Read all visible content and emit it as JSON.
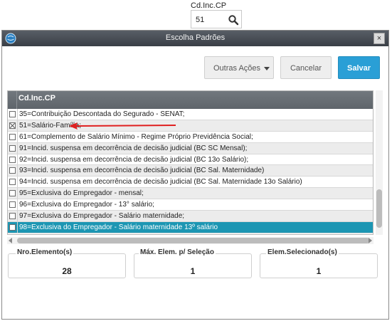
{
  "field": {
    "label": "Cd.Inc.CP",
    "value": "51",
    "icon": "search-icon"
  },
  "dialog": {
    "title": "Escolha Padrões",
    "close_label": "×",
    "app_icon": "app-globe-icon"
  },
  "toolbar": {
    "actions_label": "Outras Ações",
    "cancel_label": "Cancelar",
    "save_label": "Salvar"
  },
  "grid": {
    "column_header": "Cd.Inc.CP",
    "rows": [
      {
        "text": "35=Contribuição Descontada do Segurado - SENAT;",
        "checked": false
      },
      {
        "text": "51=Salário-Família;",
        "checked": true
      },
      {
        "text": "61=Complemento de Salário Mínimo - Regime Próprio Previdência Social;",
        "checked": false
      },
      {
        "text": "91=Incid. suspensa em decorrência de decisão judicial (BC SC Mensal);",
        "checked": false
      },
      {
        "text": "92=Incid. suspensa em decorrência de decisão judicial (BC 13o Salário);",
        "checked": false
      },
      {
        "text": "93=Incid. suspensa em decorrência de decisão judicial  (BC Sal. Maternidade)",
        "checked": false
      },
      {
        "text": "94=Incid. suspensa em decorrência de decisão judicial (BC Sal. Maternidade 13o   Salário)",
        "checked": false
      },
      {
        "text": "95=Exclusiva do Empregador - mensal;",
        "checked": false
      },
      {
        "text": "96=Exclusiva do Empregador - 13° salário;",
        "checked": false
      },
      {
        "text": "97=Exclusiva do Empregador - Salário maternidade;",
        "checked": false
      },
      {
        "text": "98=Exclusiva do Empregador - Salário maternidade 13º salário",
        "checked": false
      }
    ],
    "active_row_color": "#1c96b3",
    "annotation_color": "#e02020"
  },
  "summary": {
    "elements_label": "Nro.Elemento(s)",
    "elements_value": "28",
    "max_label": "Máx. Elem. p/ Seleção",
    "max_value": "1",
    "selected_label": "Elem.Selecionado(s)",
    "selected_value": "1"
  }
}
